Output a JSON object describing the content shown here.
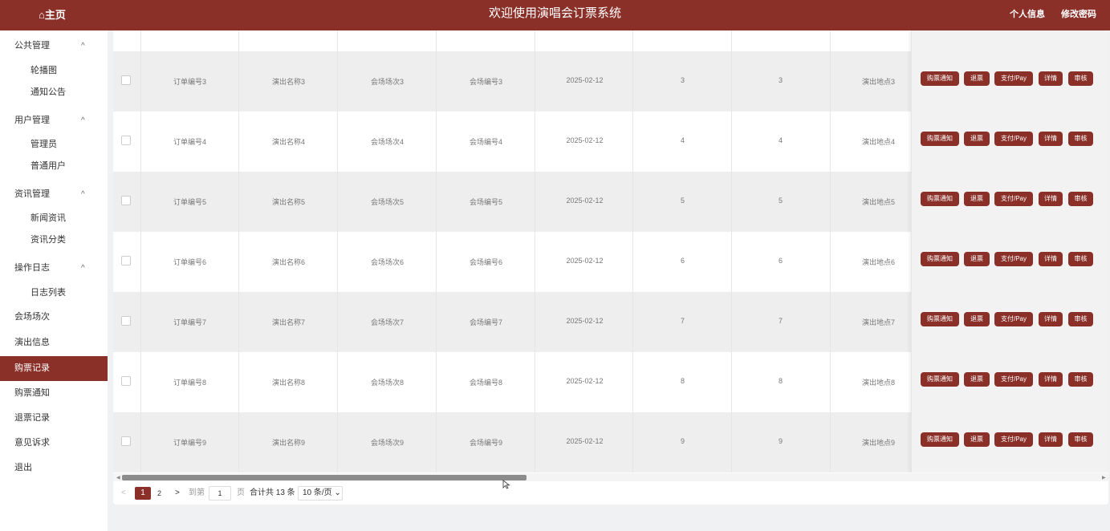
{
  "header": {
    "home": "⌂主页",
    "title": "欢迎使用演唱会订票系统",
    "profile": "个人信息",
    "change_password": "修改密码"
  },
  "sidebar": {
    "groups": [
      {
        "label": "公共管理",
        "chevron": "^",
        "items": [
          "轮播图",
          "通知公告"
        ]
      },
      {
        "label": "用户管理",
        "chevron": "^",
        "items": [
          "管理员",
          "普通用户"
        ]
      },
      {
        "label": "资讯管理",
        "chevron": "^",
        "items": [
          "新闻资讯",
          "资讯分类"
        ]
      },
      {
        "label": "操作日志",
        "chevron": "^",
        "items": [
          "日志列表"
        ]
      }
    ],
    "items": [
      "会场场次",
      "演出信息",
      "购票记录",
      "购票通知",
      "退票记录",
      "意见诉求",
      "退出"
    ],
    "active": "购票记录"
  },
  "table": {
    "rows": [
      {
        "order": "订单编号3",
        "show": "演出名称3",
        "session": "会场场次3",
        "venue": "会场编号3",
        "date": "2025-02-12",
        "a": "3",
        "b": "3",
        "place": "演出地点3"
      },
      {
        "order": "订单编号4",
        "show": "演出名称4",
        "session": "会场场次4",
        "venue": "会场编号4",
        "date": "2025-02-12",
        "a": "4",
        "b": "4",
        "place": "演出地点4"
      },
      {
        "order": "订单编号5",
        "show": "演出名称5",
        "session": "会场场次5",
        "venue": "会场编号5",
        "date": "2025-02-12",
        "a": "5",
        "b": "5",
        "place": "演出地点5"
      },
      {
        "order": "订单编号6",
        "show": "演出名称6",
        "session": "会场场次6",
        "venue": "会场编号6",
        "date": "2025-02-12",
        "a": "6",
        "b": "6",
        "place": "演出地点6"
      },
      {
        "order": "订单编号7",
        "show": "演出名称7",
        "session": "会场场次7",
        "venue": "会场编号7",
        "date": "2025-02-12",
        "a": "7",
        "b": "7",
        "place": "演出地点7"
      },
      {
        "order": "订单编号8",
        "show": "演出名称8",
        "session": "会场场次8",
        "venue": "会场编号8",
        "date": "2025-02-12",
        "a": "8",
        "b": "8",
        "place": "演出地点8"
      },
      {
        "order": "订单编号9",
        "show": "演出名称9",
        "session": "会场场次9",
        "venue": "会场编号9",
        "date": "2025-02-12",
        "a": "9",
        "b": "9",
        "place": "演出地点9"
      }
    ],
    "actions": [
      "购票通知",
      "退票",
      "支付/Pay",
      "详情",
      "审核"
    ]
  },
  "pagination": {
    "prev": "<",
    "page1": "1",
    "page2": "2",
    "next": ">",
    "goto_label": "到第",
    "goto_value": "1",
    "page_suffix": "页",
    "total": "合计共 13 条",
    "page_size": "10 条/页 ⌄"
  },
  "colors": {
    "brand": "#8a3028",
    "row_grey": "#eeeeee"
  }
}
